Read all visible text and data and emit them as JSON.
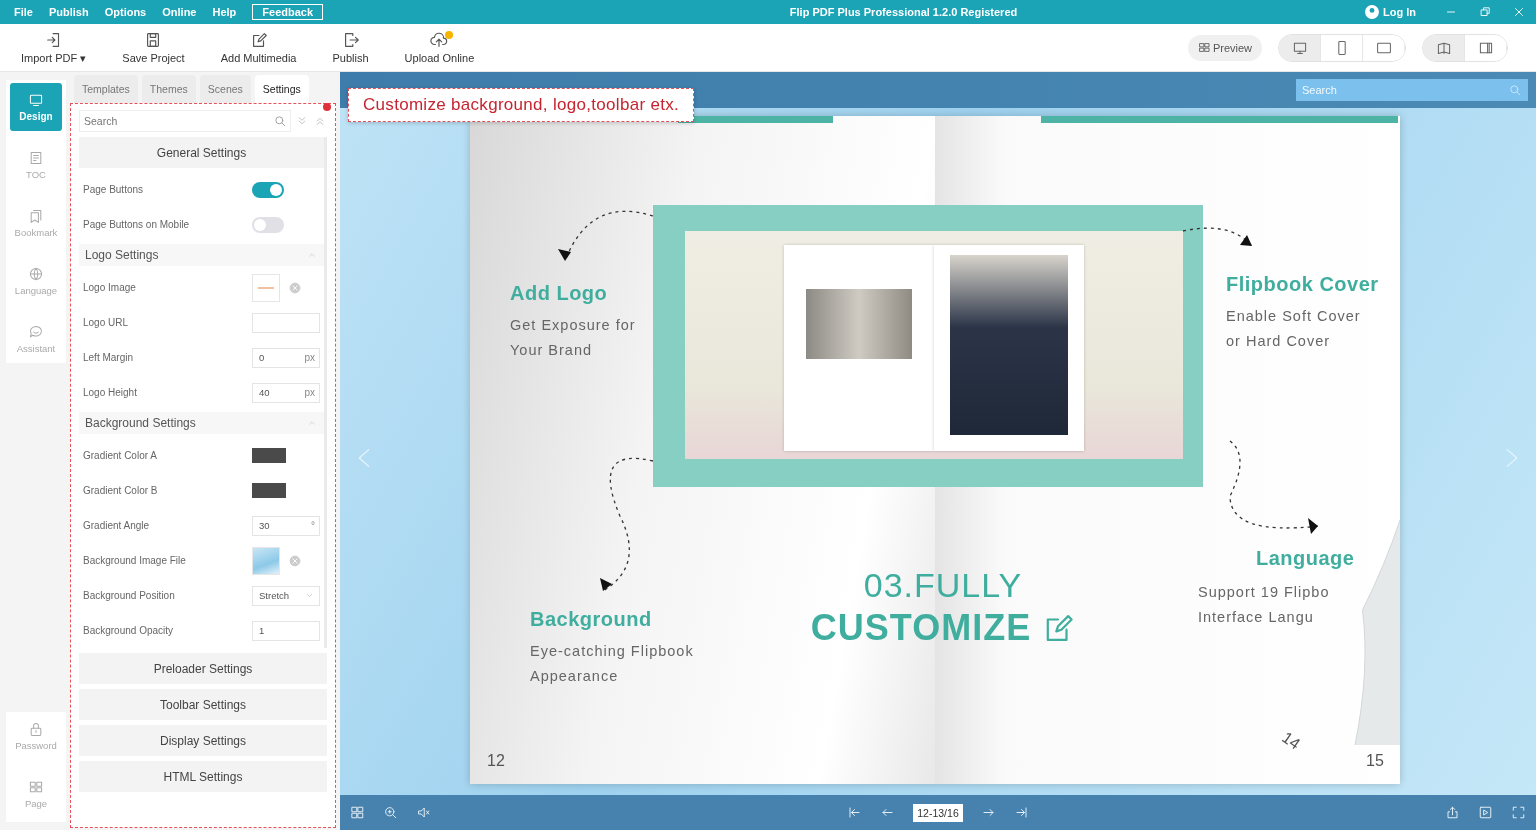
{
  "window": {
    "menu": [
      "File",
      "Publish",
      "Options",
      "Online",
      "Help"
    ],
    "feedback": "Feedback",
    "title": "Flip PDF Plus Professional 1.2.0 Registered",
    "login": "Log In"
  },
  "toolbar": [
    {
      "label": "Import PDF ▾",
      "kind": "import"
    },
    {
      "label": "Save Project",
      "kind": "save"
    },
    {
      "label": "Add Multimedia",
      "kind": "edit"
    },
    {
      "label": "Publish",
      "kind": "publish"
    },
    {
      "label": "Upload Online",
      "kind": "upload"
    }
  ],
  "view": {
    "preview": "Preview",
    "devices": [
      {
        "kind": "desktop",
        "selected": true
      },
      {
        "kind": "phone",
        "selected": false
      },
      {
        "kind": "tablet",
        "selected": false
      }
    ],
    "layouts": [
      {
        "kind": "double",
        "selected": true
      },
      {
        "kind": "single",
        "selected": false
      }
    ]
  },
  "rail": [
    {
      "label": "Design",
      "kind": "design",
      "selected": true
    },
    {
      "label": "TOC",
      "kind": "toc",
      "selected": false
    },
    {
      "label": "Bookmark",
      "kind": "bookmark",
      "selected": false
    },
    {
      "label": "Language",
      "kind": "language",
      "selected": false
    },
    {
      "label": "Assistant",
      "kind": "assistant",
      "selected": false
    }
  ],
  "rail_bottom": [
    {
      "label": "Password",
      "kind": "lock"
    },
    {
      "label": "Page",
      "kind": "page"
    }
  ],
  "panel": {
    "tabs": [
      {
        "label": "Templates",
        "selected": false
      },
      {
        "label": "Themes",
        "selected": false
      },
      {
        "label": "Scenes",
        "selected": false
      },
      {
        "label": "Settings",
        "selected": true
      }
    ],
    "search": {
      "placeholder": "Search"
    },
    "rows": [
      {
        "kind": "section",
        "label": "General Settings"
      },
      {
        "kind": "toggle",
        "label": "Page Buttons",
        "on": true
      },
      {
        "kind": "toggle",
        "label": "Page Buttons on Mobile",
        "on": false
      },
      {
        "kind": "group",
        "label": "Logo Settings",
        "expanded": true
      },
      {
        "kind": "image",
        "label": "Logo Image"
      },
      {
        "kind": "input",
        "label": "Logo URL"
      },
      {
        "kind": "input",
        "label": "Left Margin",
        "value": "0",
        "unit": "px"
      },
      {
        "kind": "input",
        "label": "Logo Height",
        "value": "40",
        "unit": "px"
      },
      {
        "kind": "group",
        "label": "Background Settings",
        "expanded": true
      },
      {
        "kind": "color",
        "label": "Gradient Color A",
        "color": "#4a4a4a"
      },
      {
        "kind": "color",
        "label": "Gradient Color B",
        "color": "#4a4a4a"
      },
      {
        "kind": "input",
        "label": "Gradient Angle",
        "value": "30",
        "unit": "°"
      },
      {
        "kind": "image",
        "label": "Background Image File"
      },
      {
        "kind": "select",
        "label": "Background Position",
        "value": "Stretch"
      },
      {
        "kind": "input",
        "label": "Background Opacity",
        "value": "1"
      }
    ],
    "sections": [
      "Preloader Settings",
      "Toolbar Settings",
      "Display Settings",
      "HTML Settings"
    ]
  },
  "callout": "Customize background, logo,toolbar etx.",
  "preview": {
    "search": {
      "placeholder": "Search"
    },
    "left_page": {
      "number": "12",
      "blocks": [
        {
          "kind": "logo",
          "title": "Add Logo",
          "lines": [
            "Get Exposure for",
            "Your Brand"
          ]
        },
        {
          "kind": "background",
          "title": "Background",
          "lines": [
            "Eye-catching Flipbook",
            "Appearance"
          ]
        }
      ]
    },
    "right_page": {
      "number": "15",
      "curl_number": "14",
      "blocks": [
        {
          "kind": "cover",
          "title": "Flipbook Cover",
          "lines": [
            "Enable Soft Cover",
            "or Hard Cover"
          ]
        },
        {
          "kind": "language",
          "title": "Language",
          "lines": [
            "Support 19 Flipbo",
            "Interface Langu"
          ]
        }
      ]
    },
    "headline": {
      "line1": "03.FULLY",
      "line2": "CUSTOMIZE"
    },
    "page_indicator": "12-13/16"
  }
}
